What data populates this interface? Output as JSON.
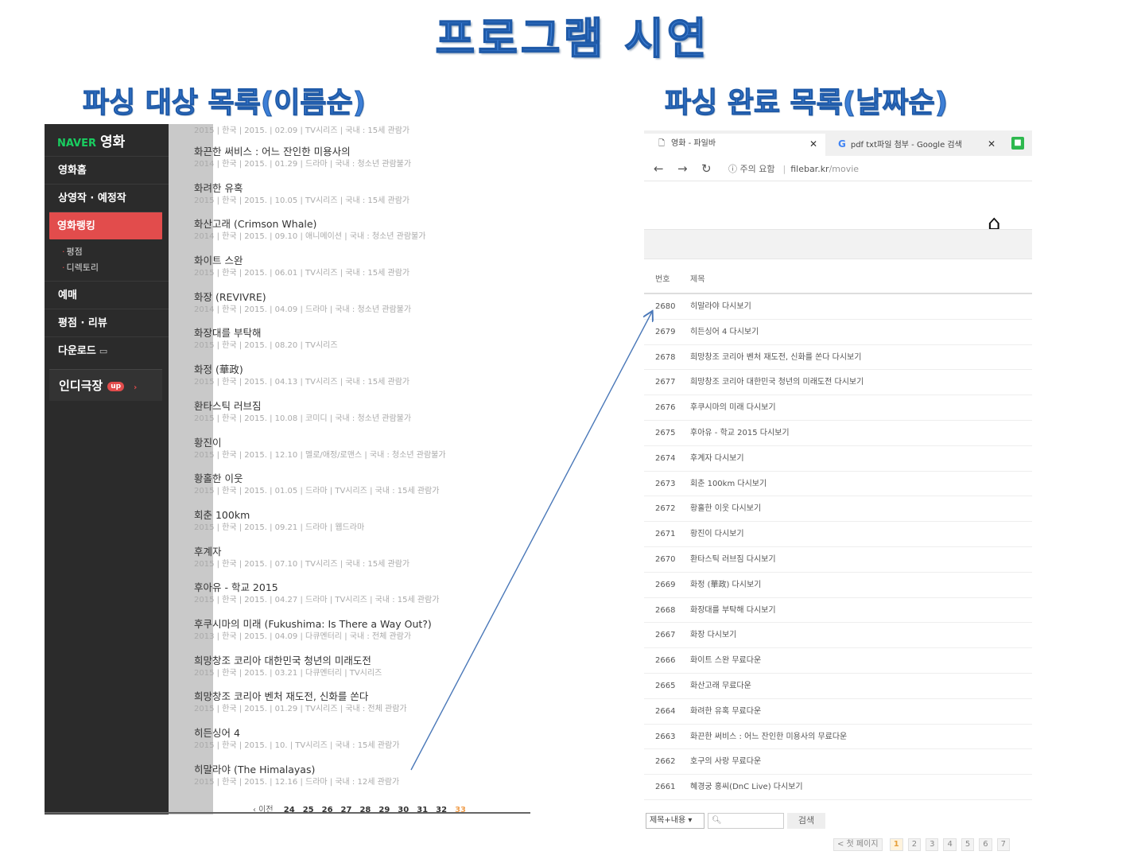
{
  "slide": {
    "title": "프로그램 시연",
    "left_heading": "파싱 대상 목록(이름순)",
    "right_heading": "파싱 완료 목록(날짜순)"
  },
  "naver": {
    "brand": "NAVER",
    "logo_text": "영화",
    "menu": [
      "영화홈",
      "상영작 · 예정작",
      "영화랭킹"
    ],
    "sub_menu": [
      "평점",
      "디렉토리"
    ],
    "menu2": [
      "예매",
      "평점 · 리뷰",
      "다운로드"
    ],
    "indie_label": "인디극장",
    "indie_badge": "up",
    "first_info": "2015 | 한국 | 2015. | 02.09 | TV시리즈 | 국내 : 15세 관람가",
    "movies": [
      {
        "title": "화끈한 써비스 : 어느 잔인한 미용사의",
        "info": "2014 | 한국 | 2015. | 01.29 | 드라마 | 국내 : 청소년 관람불가"
      },
      {
        "title": "화려한 유혹",
        "info": "2015 | 한국 | 2015. | 10.05 | TV시리즈 | 국내 : 15세 관람가"
      },
      {
        "title": "화산고래 (Crimson Whale)",
        "info": "2014 | 한국 | 2015. | 09.10 | 애니메이션 | 국내 : 청소년 관람불가"
      },
      {
        "title": "화이트 스완",
        "info": "2015 | 한국 | 2015. | 06.01 | TV시리즈 | 국내 : 15세 관람가"
      },
      {
        "title": "화장 (REVIVRE)",
        "info": "2014 | 한국 | 2015. | 04.09 | 드라마 | 국내 : 청소년 관람불가"
      },
      {
        "title": "화장대를 부탁해",
        "info": "2015 | 한국 | 2015. | 08.20 | TV시리즈"
      },
      {
        "title": "화정 (華政)",
        "info": "2015 | 한국 | 2015. | 04.13 | TV시리즈 | 국내 : 15세 관람가"
      },
      {
        "title": "환타스틱 러브짐",
        "info": "2015 | 한국 | 2015. | 10.08 | 코미디 | 국내 : 청소년 관람불가"
      },
      {
        "title": "황진이",
        "info": "2015 | 한국 | 2015. | 12.10 | 멜로/애정/로맨스 | 국내 : 청소년 관람불가"
      },
      {
        "title": "황홀한 이웃",
        "info": "2015 | 한국 | 2015. | 01.05 | 드라마 | TV시리즈 | 국내 : 15세 관람가"
      },
      {
        "title": "회춘 100km",
        "info": "2015 | 한국 | 2015. | 09.21 | 드라마 | 웹드라마"
      },
      {
        "title": "후계자",
        "info": "2015 | 한국 | 2015. | 07.10 | TV시리즈 | 국내 : 15세 관람가"
      },
      {
        "title": "후아유 - 학교 2015",
        "info": "2015 | 한국 | 2015. | 04.27 | 드라마 | TV시리즈 | 국내 : 15세 관람가"
      },
      {
        "title": "후쿠시마의 미래 (Fukushima: Is There a Way Out?)",
        "info": "2013 | 한국 | 2015. | 04.09 | 다큐멘터리 | 국내 : 전체 관람가"
      },
      {
        "title": "희망창조 코리아 대한민국 청년의 미래도전",
        "info": "2015 | 한국 | 2015. | 03.21 | 다큐멘터리 | TV시리즈"
      },
      {
        "title": "희망창조 코리아 벤처 재도전, 신화를 쏜다",
        "info": "2015 | 한국 | 2015. | 01.29 | TV시리즈 | 국내 : 전체 관람가"
      },
      {
        "title": "히든싱어 4",
        "info": "2015 | 한국 | 2015. | 10. | TV시리즈 | 국내 : 15세 관람가"
      },
      {
        "title": "히말라야 (The Himalayas)",
        "info": "2015 | 한국 | 2015. | 12.16 | 드라마 | 국내 : 12세 관람가"
      }
    ],
    "pager": {
      "prev": "‹ 이전",
      "pages": [
        "24",
        "25",
        "26",
        "27",
        "28",
        "29",
        "30",
        "31",
        "32"
      ],
      "current": "33"
    }
  },
  "browser": {
    "tab1": "영화 - 파일바",
    "tab2": "pdf txt파일 첨부 - Google 검색",
    "address_warning": "ⓘ 주의 요함",
    "address_domain": "filebar.kr",
    "address_path": "/movie",
    "table_headers": {
      "no": "번호",
      "title": "제목"
    },
    "rows": [
      {
        "no": "2680",
        "title": "히말라야 다시보기"
      },
      {
        "no": "2679",
        "title": "히든싱어 4 다시보기"
      },
      {
        "no": "2678",
        "title": "희망창조 코리아 벤처 재도전, 신화를 쏜다 다시보기"
      },
      {
        "no": "2677",
        "title": "희망창조 코리아 대한민국 청년의 미래도전 다시보기"
      },
      {
        "no": "2676",
        "title": "후쿠시마의 미래 다시보기"
      },
      {
        "no": "2675",
        "title": "후아유 - 학교 2015 다시보기"
      },
      {
        "no": "2674",
        "title": "후계자 다시보기"
      },
      {
        "no": "2673",
        "title": "회춘 100km 다시보기"
      },
      {
        "no": "2672",
        "title": "황홀한 이웃 다시보기"
      },
      {
        "no": "2671",
        "title": "황진이 다시보기"
      },
      {
        "no": "2670",
        "title": "환타스틱 러브짐 다시보기"
      },
      {
        "no": "2669",
        "title": "화정 (華政) 다시보기"
      },
      {
        "no": "2668",
        "title": "화장대를 부탁해 다시보기"
      },
      {
        "no": "2667",
        "title": "화장 다시보기"
      },
      {
        "no": "2666",
        "title": "화이트 스완 무료다운"
      },
      {
        "no": "2665",
        "title": "화산고래 무료다운"
      },
      {
        "no": "2664",
        "title": "화려한 유혹 무료다운"
      },
      {
        "no": "2663",
        "title": "화끈한 써비스 : 어느 잔인한 미용사의 무료다운"
      },
      {
        "no": "2662",
        "title": "호구의 사랑 무료다운"
      },
      {
        "no": "2661",
        "title": "혜경궁 홍씨(DnC Live) 다시보기"
      }
    ],
    "search_select": "제목+내용",
    "search_button": "검색",
    "pager": {
      "first": "< 첫 페이지",
      "pages": [
        "2",
        "3",
        "4",
        "5",
        "6",
        "7"
      ],
      "current": "1"
    }
  },
  "colors": {
    "title_blue": "#3d7fd6",
    "naver_green": "#19ce60",
    "naver_red": "#e24c4c",
    "arrow": "#4a78b8"
  }
}
